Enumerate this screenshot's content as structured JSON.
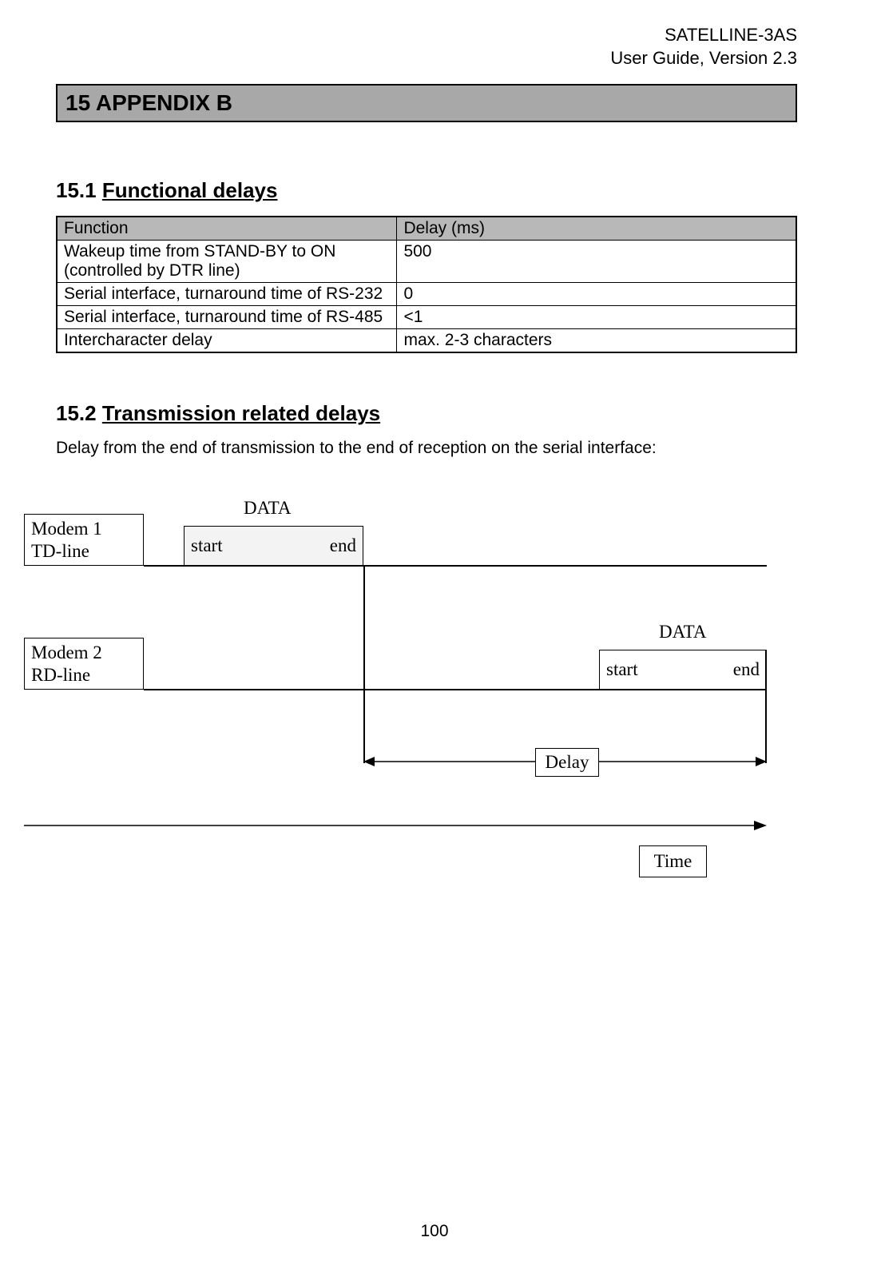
{
  "header": {
    "product": "SATELLINE-3AS",
    "guide": "User Guide, Version 2.3"
  },
  "section_bar": "15 APPENDIX B",
  "s1": {
    "num": "15.1",
    "title": "Functional delays",
    "th1": "Function",
    "th2": "Delay (ms)",
    "rows": [
      {
        "f": "Wakeup time from STAND-BY to ON (controlled by DTR line)",
        "d": "500"
      },
      {
        "f": "Serial interface, turnaround time of RS-232",
        "d": "0"
      },
      {
        "f": "Serial interface, turnaround time of RS-485",
        "d": "<1"
      },
      {
        "f": "Intercharacter delay",
        "d": "max. 2-3 characters"
      }
    ]
  },
  "s2": {
    "num": "15.2",
    "title": "Transmission related delays",
    "desc": "Delay from the end of transmission to the end of reception on the serial interface:"
  },
  "diagram": {
    "modem1_l1": "Modem 1",
    "modem1_l2": "TD-line",
    "modem2_l1": "Modem 2",
    "modem2_l2": "RD-line",
    "data": "DATA",
    "start": "start",
    "end": "end",
    "delay": "Delay",
    "time": "Time"
  },
  "page": "100"
}
